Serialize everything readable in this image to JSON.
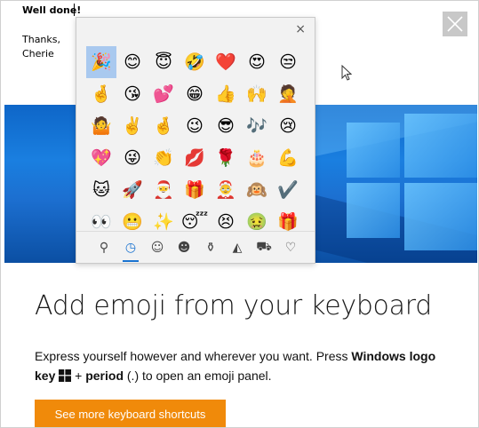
{
  "email": {
    "greeting": "Well done!",
    "signoff": "Thanks,",
    "signature": "Cherie"
  },
  "emoji_panel": {
    "close_glyph": "×",
    "emojis": [
      "🎉",
      "😊",
      "😇",
      "🤣",
      "❤️",
      "😍",
      "😒",
      "🤞",
      "😘",
      "💕",
      "😁",
      "👍",
      "🙌",
      "🤦",
      "🤷",
      "✌️",
      "🤞",
      "😉",
      "😎",
      "🎶",
      "😢",
      "💖",
      "😜",
      "👏",
      "💋",
      "🌹",
      "🎂",
      "💪",
      "🐱",
      "🚀",
      "🎅",
      "🎁",
      "🤶",
      "🙉",
      "✔️",
      "👀",
      "😬",
      "✨",
      "😴",
      "😣",
      "🤢",
      "🎁"
    ],
    "selected_index": 0,
    "tabs": [
      {
        "name": "tab-search",
        "glyph": "⚲"
      },
      {
        "name": "tab-recent",
        "glyph": "◷"
      },
      {
        "name": "tab-smileys",
        "glyph": "☺"
      },
      {
        "name": "tab-people",
        "glyph": "☻"
      },
      {
        "name": "tab-celebration",
        "glyph": "⚱"
      },
      {
        "name": "tab-food",
        "glyph": "◭"
      },
      {
        "name": "tab-travel",
        "glyph": "⛟"
      },
      {
        "name": "tab-symbols",
        "glyph": "♡"
      }
    ],
    "active_tab_index": 1
  },
  "content": {
    "heading": "Add emoji from your keyboard",
    "desc_part1": "Express yourself however and wherever you want. Press ",
    "desc_bold1": "Windows logo key",
    "desc_part2": " + ",
    "desc_bold2": "period",
    "desc_part3": " (.) to open an emoji panel.",
    "cta_label": "See more keyboard shortcuts"
  },
  "colors": {
    "cta": "#f08a0a",
    "wallpaper": "#1a7fe0",
    "selection": "#a9c9ef"
  }
}
